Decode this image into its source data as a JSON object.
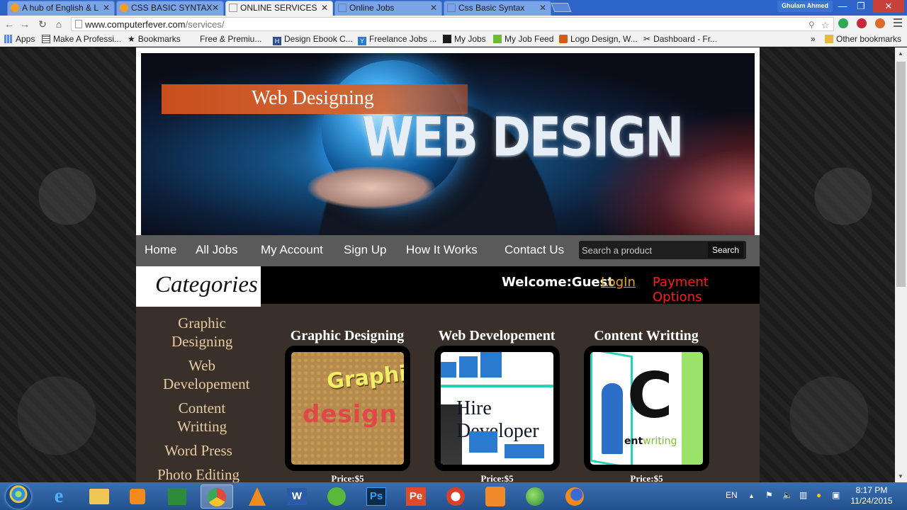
{
  "browser": {
    "tabs": [
      {
        "title": "A hub of English & L",
        "active": false,
        "favicon_color": "#f0a020"
      },
      {
        "title": "CSS BASIC SYNTAX",
        "active": false,
        "favicon_color": "#f0a020"
      },
      {
        "title": "ONLINE SERVICES",
        "active": true,
        "favicon_color": "#d8d8d8"
      },
      {
        "title": "Online Jobs",
        "active": false,
        "favicon_color": "#d8d8d8"
      },
      {
        "title": "Css Basic Syntax",
        "active": false,
        "favicon_color": "#d8d8d8"
      }
    ],
    "user_name": "Ghulam Ahmed",
    "window_buttons": {
      "minimize": "—",
      "restore": "❐",
      "close": "✕"
    },
    "url_host": "www.computerfever.com",
    "url_path": "/services/",
    "bookmarks": [
      {
        "label": "Apps",
        "icon": "apps-grid-icon"
      },
      {
        "label": "Make A Professi...",
        "icon": "grid-icon"
      },
      {
        "label": "Bookmarks",
        "icon": "star-icon"
      },
      {
        "label": "Free & Premiu...",
        "icon": "none"
      },
      {
        "label": "Design Ebook C...",
        "icon": "h-icon"
      },
      {
        "label": "Freelance Jobs ...",
        "icon": "y-icon"
      },
      {
        "label": "My Jobs",
        "icon": "ctrl-icon"
      },
      {
        "label": "My Job Feed",
        "icon": "upwork-icon"
      },
      {
        "label": "Logo Design, W...",
        "icon": "logo-icon"
      },
      {
        "label": "Dashboard - Fr...",
        "icon": "tools-icon"
      }
    ],
    "bookmarks_overflow": "»",
    "other_bookmarks": "Other bookmarks"
  },
  "site": {
    "banner": {
      "ribbon_text": "Web Designing",
      "headline": "WEB DESIGN"
    },
    "nav": [
      {
        "label": "Home"
      },
      {
        "label": "All Jobs"
      },
      {
        "label": "My Account"
      },
      {
        "label": "Sign Up"
      },
      {
        "label": "How It Works"
      },
      {
        "label": "Contact Us"
      }
    ],
    "search": {
      "placeholder": "Search a product",
      "button": "Search"
    },
    "categories_title": "Categories",
    "welcome": "Welcome:Guest",
    "login": "LogIn",
    "payment": "Payment Options",
    "categories": [
      {
        "label": "Graphic Designing"
      },
      {
        "label": "Web Developement"
      },
      {
        "label": "Content Writting"
      },
      {
        "label": "Word Press"
      },
      {
        "label": "Photo Editing"
      }
    ],
    "services": [
      {
        "title": "Graphic Designing",
        "price": "Price:$5",
        "image_text": [
          "Graphic",
          "design"
        ]
      },
      {
        "title": "Web Developement",
        "price": "Price:$5",
        "image_text": [
          "Hire Developer"
        ]
      },
      {
        "title": "Content Writting",
        "price": "Price:$5",
        "image_text": [
          "C",
          "ent",
          "writing"
        ]
      }
    ],
    "colors": {
      "accent_orange": "#e4a020",
      "payment_red": "#ff1a1a",
      "sidebar_bg": "#393129",
      "category_text": "#e8c9a2",
      "nav_bg": "#5a5a5a"
    }
  },
  "taskbar": {
    "apps": [
      {
        "name": "internet-explorer"
      },
      {
        "name": "file-explorer"
      },
      {
        "name": "media-player"
      },
      {
        "name": "excel"
      },
      {
        "name": "chrome",
        "active": true
      },
      {
        "name": "vlc"
      },
      {
        "name": "word",
        "label": "W"
      },
      {
        "name": "corel"
      },
      {
        "name": "photoshop",
        "label": "Ps"
      },
      {
        "name": "pe-app",
        "label": "Pe"
      },
      {
        "name": "ccleaner"
      },
      {
        "name": "xampp"
      },
      {
        "name": "download-manager"
      },
      {
        "name": "firefox"
      }
    ],
    "language": "EN",
    "time": "8:17 PM",
    "date": "11/24/2015"
  }
}
